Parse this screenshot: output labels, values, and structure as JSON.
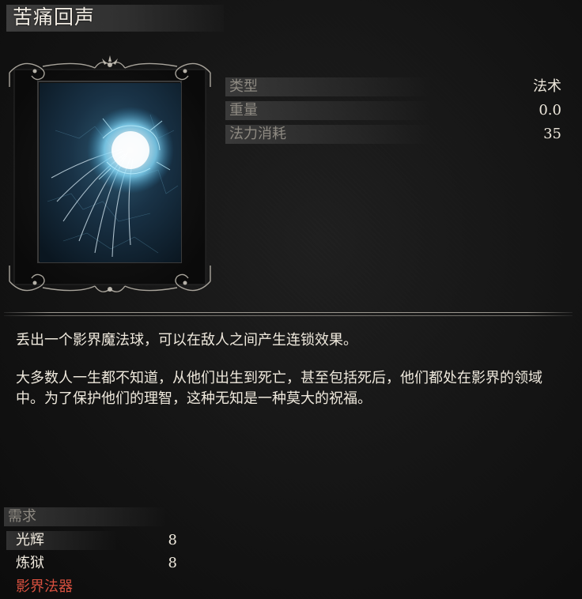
{
  "item": {
    "title": "苦痛回声"
  },
  "icon": {
    "name": "spell-orb-icon"
  },
  "stats": [
    {
      "label": "类型",
      "value": "法术"
    },
    {
      "label": "重量",
      "value": "0.0"
    },
    {
      "label": "法力消耗",
      "value": "35"
    }
  ],
  "description": {
    "effect": "丢出一个影界魔法球，可以在敌人之间产生连锁效果。",
    "lore": "大多数人一生都不知道，从他们出生到死亡，甚至包括死后，他们都处在影界的领域中。为了保护他们的理智，这种无知是一种莫大的祝福。"
  },
  "requirements": {
    "header": "需求",
    "items": [
      {
        "label": "光辉",
        "value": "8"
      },
      {
        "label": "炼狱",
        "value": "8"
      }
    ],
    "catalyst": "影界法器"
  },
  "colors": {
    "catalyst_text": "#d9503f",
    "orb_glow": "#9fe3ff"
  }
}
